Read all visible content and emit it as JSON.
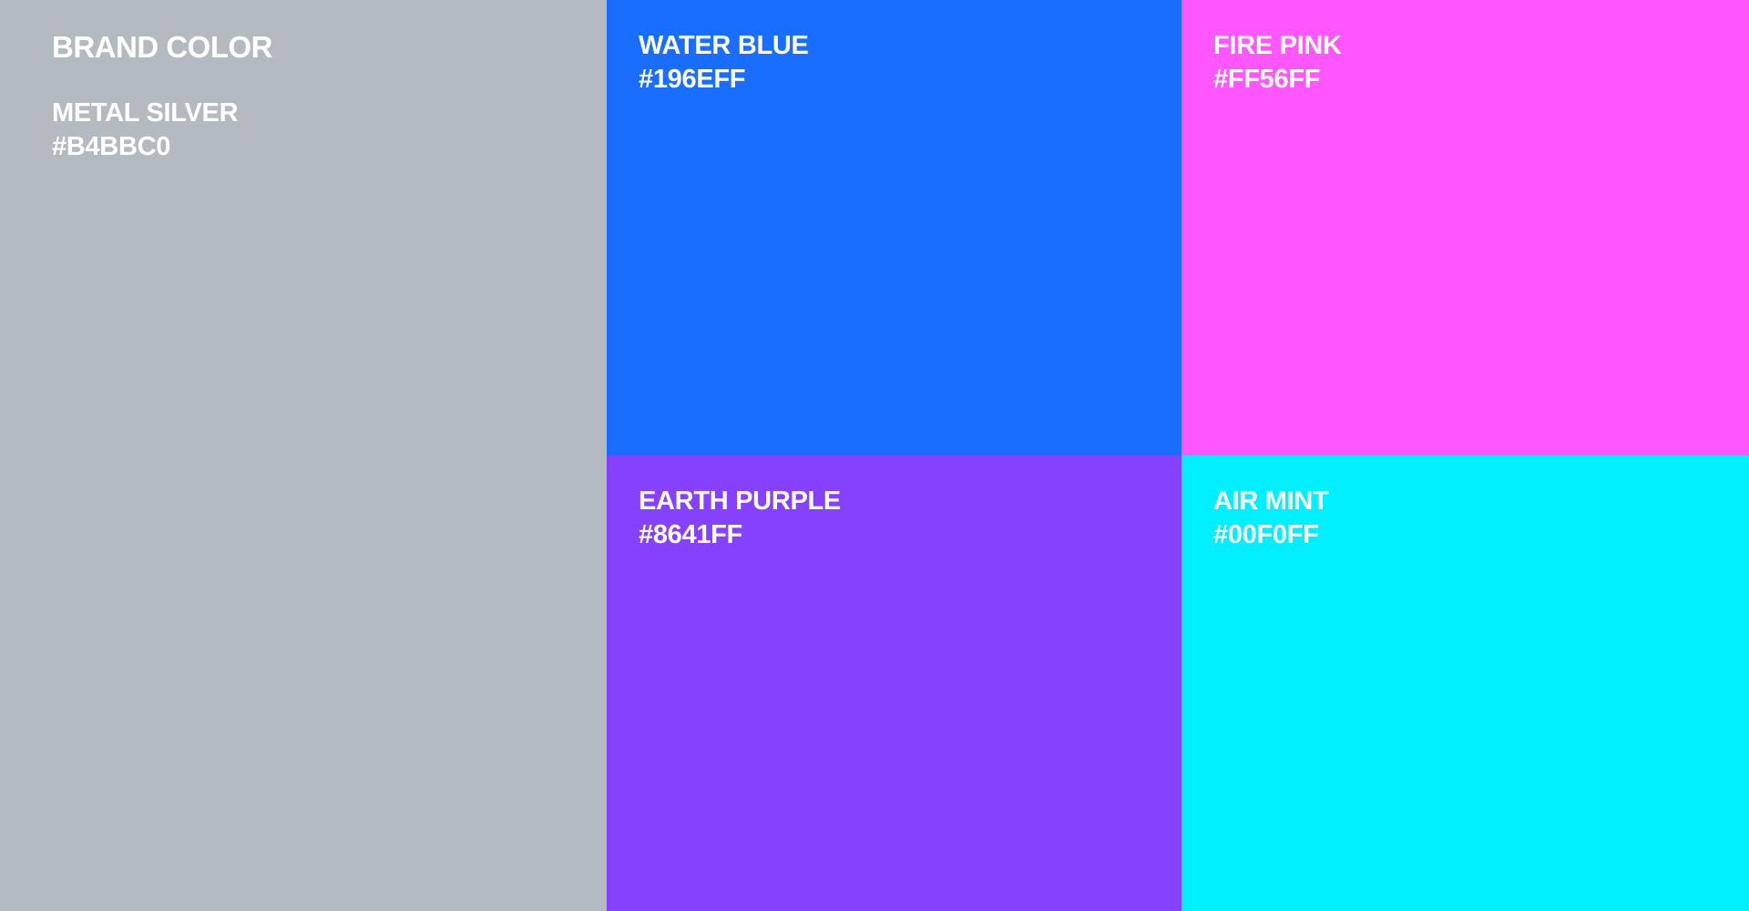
{
  "heading": "BRAND COLOR",
  "swatches": {
    "metal_silver": {
      "name": "METAL SILVER",
      "hex": "#B4BBC0",
      "color": "#B4BBC0"
    },
    "water_blue": {
      "name": "WATER BLUE",
      "hex": "#196EFF",
      "color": "#196EFF"
    },
    "fire_pink": {
      "name": "FIRE PINK",
      "hex": "#FF56FF",
      "color": "#FF56FF"
    },
    "earth_purple": {
      "name": "EARTH PURPLE",
      "hex": "#8641FF",
      "color": "#8641FF"
    },
    "air_mint": {
      "name": "AIR MINT",
      "hex": "#00F0FF",
      "color": "#00F0FF"
    }
  }
}
